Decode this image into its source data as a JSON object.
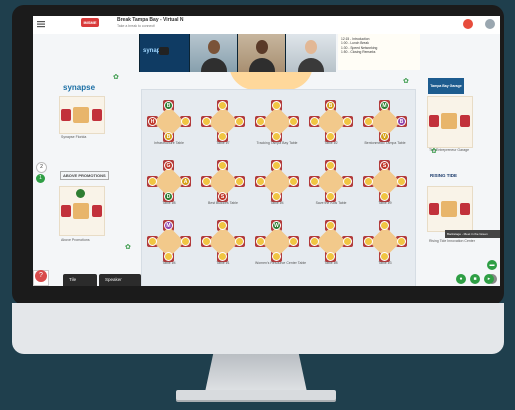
{
  "event": {
    "chip": "IMSME",
    "title": "Break Tampa Bay - Virtual N",
    "subtitle": "Take a break to connect!"
  },
  "video": {
    "logo_text": "synapse",
    "tiles": 3
  },
  "agenda": {
    "lines": [
      "12:15 - Introduction",
      "1:00 - Lunch Break",
      "1:30 - Speed Networking",
      "1:50 - Closing Remarks"
    ]
  },
  "sponsors": {
    "left_top": "synapse",
    "left_top_booth": "Synapse Florida",
    "left_bottom": "ABOVE PROMOTIONS",
    "left_bottom_booth": "Above Promotions",
    "right_top": "Tampa Bay Garage",
    "right_top_booth": "The Entrepreneur Garage",
    "right_bottom": "RISING TIDE",
    "right_bottom_booth": "Rising Tide Innovation Center"
  },
  "tables": [
    {
      "name": "Infrastructure Table",
      "seats": [
        "B",
        "H",
        "",
        "B"
      ]
    },
    {
      "name": "Table #7",
      "seats": [
        "",
        "",
        "",
        ""
      ]
    },
    {
      "name": "Tracking Tampa Bay Table",
      "seats": [
        "",
        "",
        "",
        ""
      ]
    },
    {
      "name": "Table #2",
      "seats": [
        "B",
        "",
        "",
        ""
      ]
    },
    {
      "name": "Bentonmedic Tampa Table",
      "seats": [
        "M",
        "",
        "B",
        "V"
      ]
    },
    {
      "name": "Table #8",
      "seats": [
        "G",
        "",
        "A",
        "D"
      ]
    },
    {
      "name": "Best Buddies Table",
      "seats": [
        "",
        "",
        "",
        "S"
      ]
    },
    {
      "name": "Table #4",
      "seats": [
        "",
        "",
        "",
        ""
      ]
    },
    {
      "name": "Save the Kids Table",
      "seats": [
        "",
        "",
        "",
        ""
      ]
    },
    {
      "name": "Table #9",
      "seats": [
        "S",
        "",
        "",
        ""
      ]
    },
    {
      "name": "Table #4",
      "seats": [
        "M",
        "",
        "",
        ""
      ]
    },
    {
      "name": "Table #1",
      "seats": [
        "",
        "",
        "",
        ""
      ]
    },
    {
      "name": "Women's Resource Center Table",
      "seats": [
        "W",
        "",
        "",
        ""
      ]
    },
    {
      "name": "Table #8",
      "seats": [
        "",
        "",
        "",
        ""
      ]
    },
    {
      "name": "Table #3",
      "seats": [
        "",
        "",
        "",
        ""
      ]
    }
  ],
  "sidebar": {
    "counter_one": "2",
    "counter_two": "1",
    "help_text": "Need help?"
  },
  "bottom_tabs": {
    "tile": "Tile",
    "speaker": "Speaker"
  },
  "toast": "Backstage - Meet in the Green",
  "colors": {
    "background": "#1f3f4d",
    "bezel": "#1b1b1b",
    "chair": "#c2313b",
    "table_top": "#f2c98b",
    "accent_green": "#2e9e44",
    "alert_red": "#d93b3b"
  },
  "icons": [
    "menu-icon",
    "notification-icon",
    "user-avatar-icon",
    "help-icon",
    "chat-icon",
    "mic-icon",
    "camera-icon",
    "plant-icon"
  ]
}
